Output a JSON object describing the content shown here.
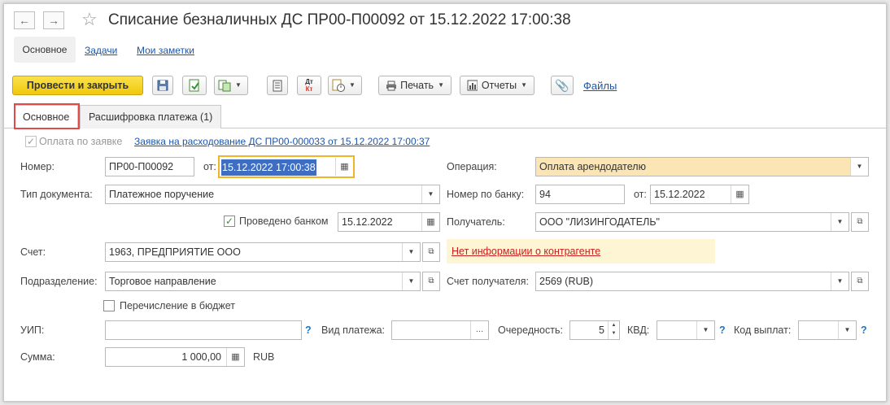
{
  "window": {
    "title": "Списание безналичных ДС ПР00-П00092 от 15.12.2022 17:00:38",
    "back_icon": "←",
    "forward_icon": "→",
    "star_icon": "☆"
  },
  "subnav": {
    "items": [
      "Основное",
      "Задачи",
      "Мои заметки"
    ]
  },
  "toolbar": {
    "post_close_label": "Провести и закрыть",
    "print_label": "Печать",
    "reports_label": "Отчеты",
    "files_label": "Файлы",
    "dt_label": "Дт",
    "kt_label": "Кт",
    "caret": "▼"
  },
  "tabs": [
    "Основное",
    "Расшифровка платежа (1)"
  ],
  "form": {
    "payment_by_request_label": "Оплата по заявке",
    "request_link": "Заявка на расходование ДС ПР00-000033 от 15.12.2022 17:00:37",
    "number_label": "Номер:",
    "number_value": "ПР00-П00092",
    "from_label": "от:",
    "date_value": "15.12.2022 17:00:38",
    "operation_label": "Операция:",
    "operation_value": "Оплата арендодателю",
    "doc_type_label": "Тип документа:",
    "doc_type_value": "Платежное поручение",
    "bank_number_label": "Номер по банку:",
    "bank_number_value": "94",
    "bank_from_label": "от:",
    "bank_date_value": "15.12.2022",
    "bank_posted_label": "Проведено банком",
    "bank_posted_date": "15.12.2022",
    "recipient_label": "Получатель:",
    "recipient_value": "ООО \"ЛИЗИНГОДАТЕЛЬ\"",
    "account_label": "Счет:",
    "account_value": "1963, ПРЕДПРИЯТИЕ ООО",
    "no_info_link": "Нет информации о контрагенте",
    "department_label": "Подразделение:",
    "department_value": "Торговое направление",
    "recipient_account_label": "Счет получателя:",
    "recipient_account_value": "2569 (RUB)",
    "budget_transfer_label": "Перечисление в бюджет",
    "uip_label": "УИП:",
    "payment_type_label": "Вид платежа:",
    "order_label": "Очередность:",
    "order_value": "5",
    "kvd_label": "КВД:",
    "payment_code_label": "Код выплат:",
    "amount_label": "Сумма:",
    "amount_value": "1 000,00",
    "currency": "RUB",
    "help_mark": "?"
  },
  "colors": {
    "primary_button": "#f5d01f",
    "operation_field_bg": "#fbe5b4",
    "date_field_border": "#f0b429",
    "selection_bg": "#3d6ec4",
    "info_bg": "#fdf5d3",
    "highlight_border": "#e04a4a",
    "link": "#1c56a8",
    "warning_link": "#c9211e"
  }
}
